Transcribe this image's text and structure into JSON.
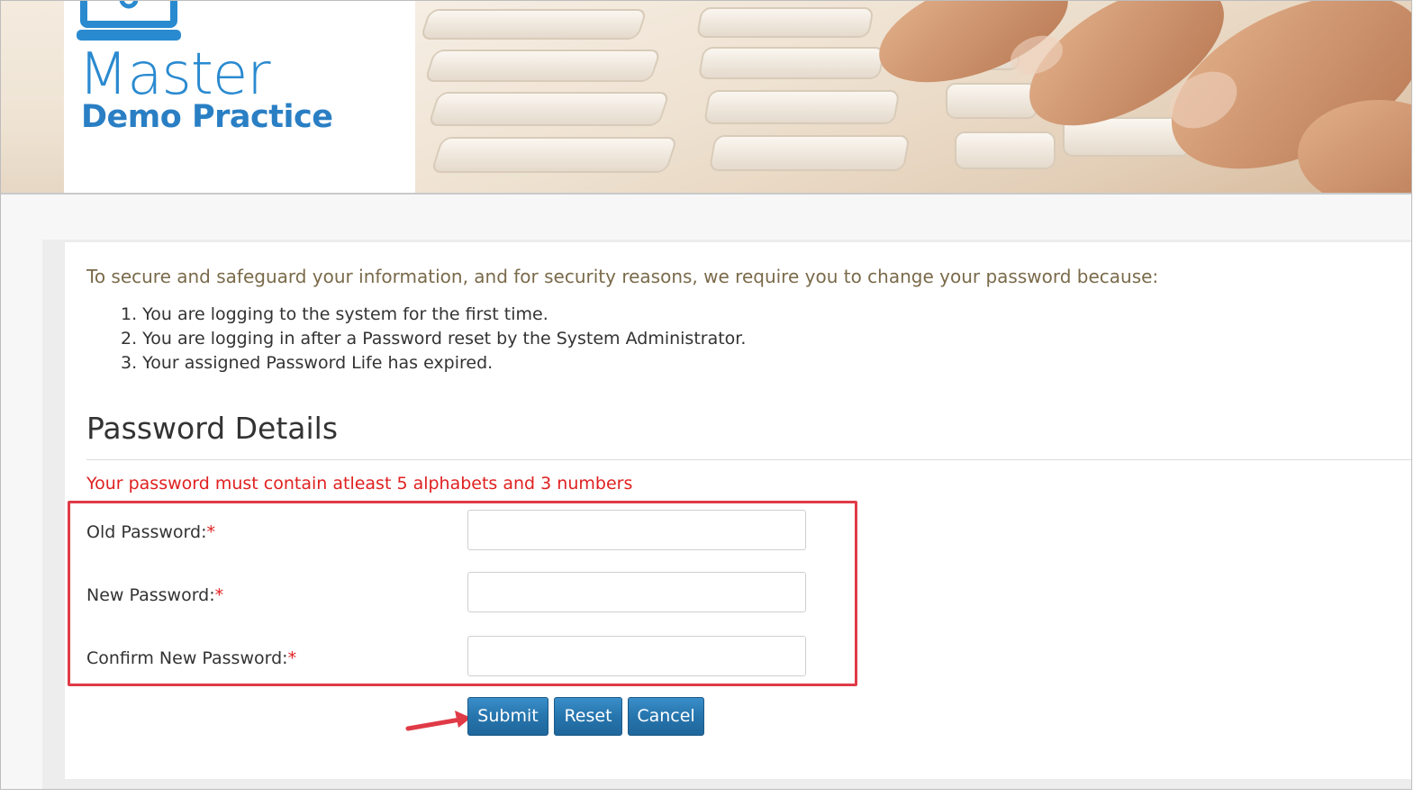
{
  "brand": {
    "line1": "Master",
    "line2": "Demo Practice",
    "color": "#2a8ad0"
  },
  "intro": {
    "text": "To secure and safeguard your information, and for security reasons, we require you to change your password because:",
    "reasons": [
      "1. You are logging to the system for the first time.",
      "2. You are logging in after a Password reset by the System Administrator.",
      "3. Your assigned Password Life has expired."
    ]
  },
  "section": {
    "title": "Password Details",
    "rule_text": "Your password must contain atleast 5 alphabets and 3 numbers"
  },
  "form": {
    "required_marker": "*",
    "fields": [
      {
        "label": "Old Password:",
        "value": ""
      },
      {
        "label": "New Password:",
        "value": ""
      },
      {
        "label": "Confirm New Password:",
        "value": ""
      }
    ]
  },
  "buttons": {
    "submit": "Submit",
    "reset": "Reset",
    "cancel": "Cancel"
  },
  "colors": {
    "primary_button": "#2675ad",
    "error_text": "#e02020",
    "highlight": "#e03a47"
  }
}
